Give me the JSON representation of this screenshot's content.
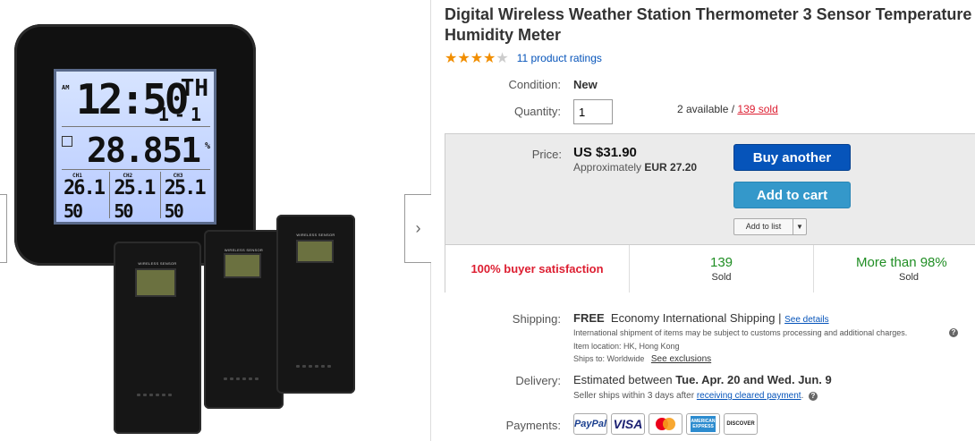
{
  "product": {
    "title": "Digital Wireless Weather Station Thermometer 3 Sensor Temperature Humidity Meter",
    "rating_stars": 4,
    "rating_stars_max": 5,
    "ratings_link": "11 product ratings"
  },
  "image": {
    "lcd": {
      "am": "AM",
      "time": "12:50",
      "day": "TH",
      "date": "1-1",
      "indoor_temp": "28.8",
      "indoor_humidity": "51",
      "percent": "%",
      "channels": [
        {
          "label": "CH1",
          "temp": "26.1",
          "humidity": "50"
        },
        {
          "label": "CH2",
          "temp": "25.1",
          "humidity": "50"
        },
        {
          "label": "CH3",
          "temp": "25.1",
          "humidity": "50"
        }
      ]
    },
    "sensor_label": "WIRELESS SENSOR",
    "next_arrow": "›"
  },
  "details": {
    "condition_label": "Condition:",
    "condition_value": "New",
    "quantity_label": "Quantity:",
    "quantity_value": "1",
    "available_text": "2 available / ",
    "sold_text": "139 sold"
  },
  "buybox": {
    "price_label": "Price:",
    "price_value": "US $31.90",
    "approx_prefix": "Approximately ",
    "approx_value": "EUR 27.20",
    "buy_another": "Buy another",
    "add_to_cart": "Add to cart",
    "add_to_list": "Add to list",
    "stats": {
      "satisfaction": "100% buyer satisfaction",
      "sold_count": "139",
      "sold_label": "Sold",
      "more_than": "More than 98%",
      "more_than_label": "Sold"
    }
  },
  "shipping": {
    "label": "Shipping:",
    "free": "FREE",
    "method": "Economy International Shipping |",
    "see_details": "See details",
    "customs_note": "International shipment of items may be subject to customs processing and additional charges.",
    "item_location": "Item location:  HK, Hong Kong",
    "ships_to_prefix": "Ships to:  Worldwide",
    "see_exclusions": "See exclusions"
  },
  "delivery": {
    "label": "Delivery:",
    "prefix": "Estimated between ",
    "range": "Tue. Apr. 20 and Wed. Jun. 9",
    "note_prefix": "Seller ships within 3 days after ",
    "note_link": "receiving cleared payment",
    "note_suffix": "."
  },
  "payments": {
    "label": "Payments:",
    "methods": [
      "PayPal",
      "VISA",
      "MasterCard",
      "AMERICAN EXPRESS",
      "DISCOVER"
    ]
  },
  "colors": {
    "link": "#0654ba",
    "buy_button": "#0654ba",
    "cart_button": "#3498ca",
    "sold_red": "#dd1e31",
    "stat_green": "#208e24",
    "star": "#f18e00"
  }
}
